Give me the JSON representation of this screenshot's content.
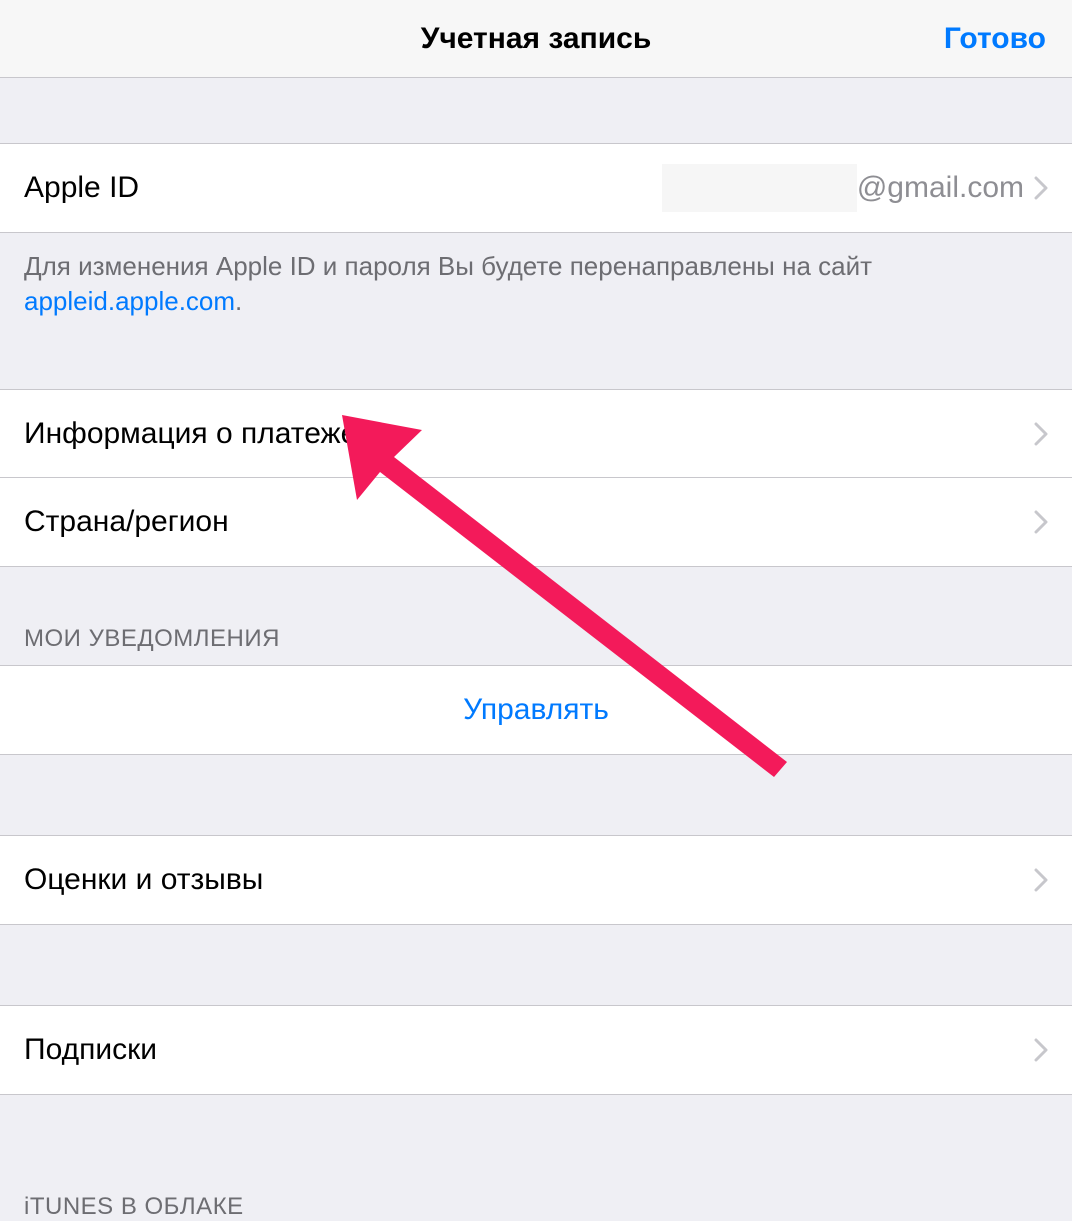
{
  "navbar": {
    "title": "Учетная запись",
    "done_label": "Готово"
  },
  "apple_id": {
    "label": "Apple ID",
    "value_suffix": "@gmail.com"
  },
  "apple_id_footer": {
    "text_before_link": "Для изменения Apple ID и пароля Вы будете перенаправлены на сайт ",
    "link_text": "appleid.apple.com",
    "text_after_link": "."
  },
  "rows": {
    "payment_info": "Информация о платеже",
    "country_region": "Страна/регион",
    "ratings_reviews": "Оценки и отзывы",
    "subscriptions": "Подписки"
  },
  "notifications": {
    "header": "МОИ УВЕДОМЛЕНИЯ",
    "manage": "Управлять"
  },
  "icloud": {
    "header": "iTUNES В ОБЛАКЕ"
  },
  "colors": {
    "link": "#007aff",
    "annotation": "#f31a5a"
  }
}
